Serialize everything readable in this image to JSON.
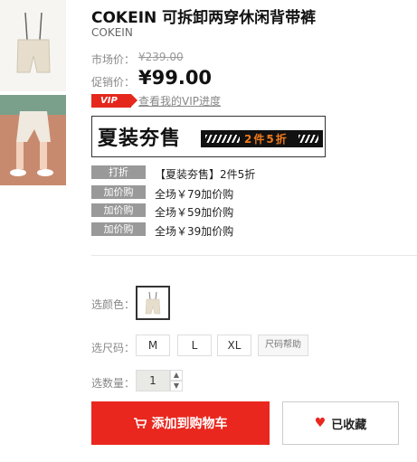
{
  "product": {
    "title": "COKEIN 可拆卸两穿休闲背带裤",
    "brand": "COKEIN"
  },
  "pricing": {
    "market_label": "市场价：",
    "market_price": "¥239.00",
    "sale_label": "促销价：",
    "sale_price": "¥99.00"
  },
  "vip": {
    "badge": "VIP",
    "link": "查看我的VIP进度"
  },
  "banner": {
    "headline": "夏装夯售",
    "deal": "2件5折"
  },
  "promotions": [
    {
      "tag": "打折",
      "text": "【夏装夯售】2件5折"
    },
    {
      "tag": "加价购",
      "text": "全场￥79加价购"
    },
    {
      "tag": "加价购",
      "text": "全场￥59加价购"
    },
    {
      "tag": "加价购",
      "text": "全场￥39加价购"
    }
  ],
  "options": {
    "color_label": "选颜色：",
    "size_label": "选尺码：",
    "sizes": [
      "M",
      "L",
      "XL"
    ],
    "size_help": "尺码帮助",
    "qty_label": "选数量：",
    "qty_value": "1",
    "qty_up_icon": "chevron-up-icon",
    "qty_down_icon": "chevron-down-icon"
  },
  "actions": {
    "add_to_cart": "添加到购物车",
    "favorited": "已收藏"
  },
  "colors": {
    "accent": "#e9271e",
    "tag_bg": "#999999",
    "banner_deal": "#f07a1e"
  }
}
